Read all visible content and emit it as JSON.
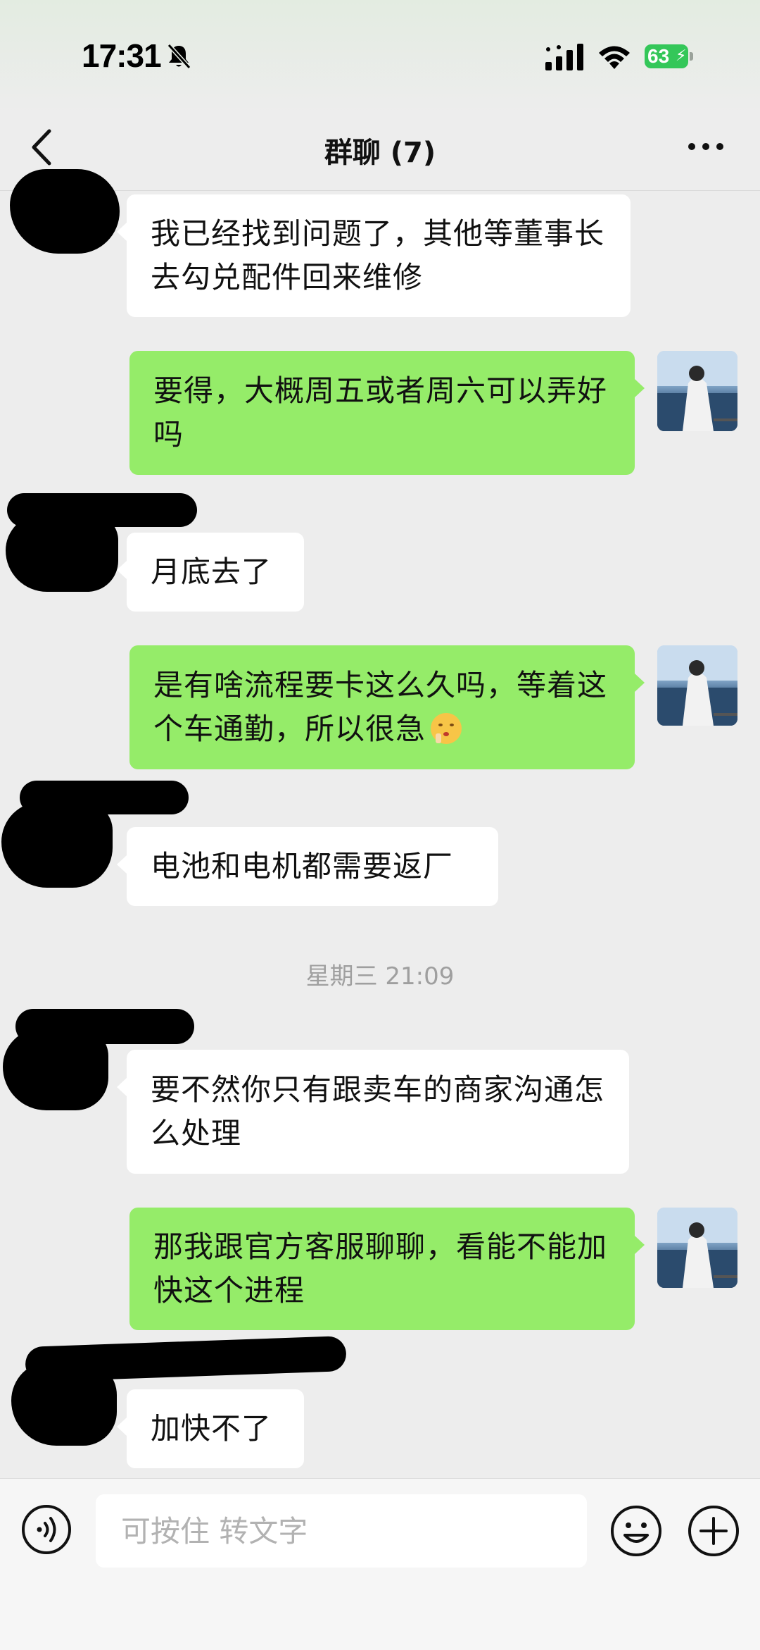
{
  "status_bar": {
    "time": "17:31",
    "battery": "63",
    "icons": [
      "bell-slash-icon",
      "signal-icon",
      "wifi-icon",
      "battery-charging-icon"
    ]
  },
  "header": {
    "title": "群聊 (7)",
    "icons": [
      "chevron-left-icon",
      "more-icon"
    ]
  },
  "messages": [
    {
      "side": "in",
      "text": "我已经找到问题了，其他等董事长去勾兑配件回来维修"
    },
    {
      "side": "out",
      "text": "要得，大概周五或者周六可以弄好吗"
    },
    {
      "side": "in",
      "text": "月底去了"
    },
    {
      "side": "out",
      "text": "是有啥流程要卡这么久吗，等着这个车通勤，所以很急"
    },
    {
      "side": "in",
      "text": "电池和电机都需要返厂"
    },
    {
      "side": "in",
      "text": "要不然你只有跟卖车的商家沟通怎么处理"
    },
    {
      "side": "out",
      "text": "那我跟官方客服聊聊，看能不能加快这个进程"
    },
    {
      "side": "in",
      "text": "加快不了"
    }
  ],
  "timestamp": "星期三 21:09",
  "input_bar": {
    "placeholder": "可按住 转文字",
    "icons": [
      "voice-icon",
      "emoji-icon",
      "plus-icon"
    ]
  },
  "colors": {
    "background": "#ededed",
    "outgoing_bubble": "#95ec69",
    "incoming_bubble": "#ffffff",
    "battery": "#34c759"
  }
}
